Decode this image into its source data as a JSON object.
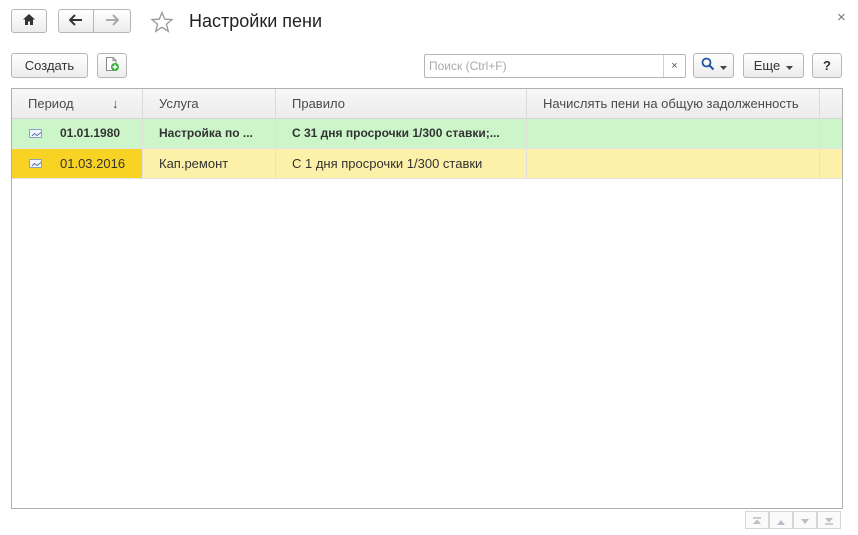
{
  "window": {
    "title": "Настройки пени",
    "close_symbol": "×"
  },
  "toolbar": {
    "create_label": "Создать",
    "search_placeholder": "Поиск (Ctrl+F)",
    "search_value": "",
    "clear_symbol": "×",
    "more_label": "Еще",
    "help_label": "?"
  },
  "table": {
    "columns": [
      {
        "label": "Период",
        "sort_indicator": "↓"
      },
      {
        "label": "Услуга"
      },
      {
        "label": "Правило"
      },
      {
        "label": "Начислять пени на общую задолженность"
      }
    ],
    "rows": [
      {
        "period": "01.01.1980",
        "service": "Настройка по ...",
        "rule": "С 31 дня просрочки 1/300 ставки;...",
        "accrue_on_total": "",
        "highlight": "#ccf5c9",
        "bold": true
      },
      {
        "period": "01.03.2016",
        "service": "Кап.ремонт",
        "rule": "С 1 дня просрочки 1/300 ставки",
        "accrue_on_total": "",
        "highlight": "#fdf0a8",
        "bold": false,
        "selected": true
      }
    ]
  },
  "icons": {
    "home": "home-icon",
    "back": "arrow-left-icon",
    "forward": "arrow-right-icon",
    "favorite": "star-icon",
    "add_copy": "add-document-icon",
    "search": "magnifier-icon",
    "row": "register-record-icon",
    "nav_first": "scroll-to-first-icon",
    "nav_up": "scroll-up-icon",
    "nav_down": "scroll-down-icon",
    "nav_last": "scroll-to-last-icon"
  },
  "colors": {
    "active_row": "#fdf0a8",
    "active_cell": "#f9d324",
    "green_row": "#ccf5c9"
  }
}
